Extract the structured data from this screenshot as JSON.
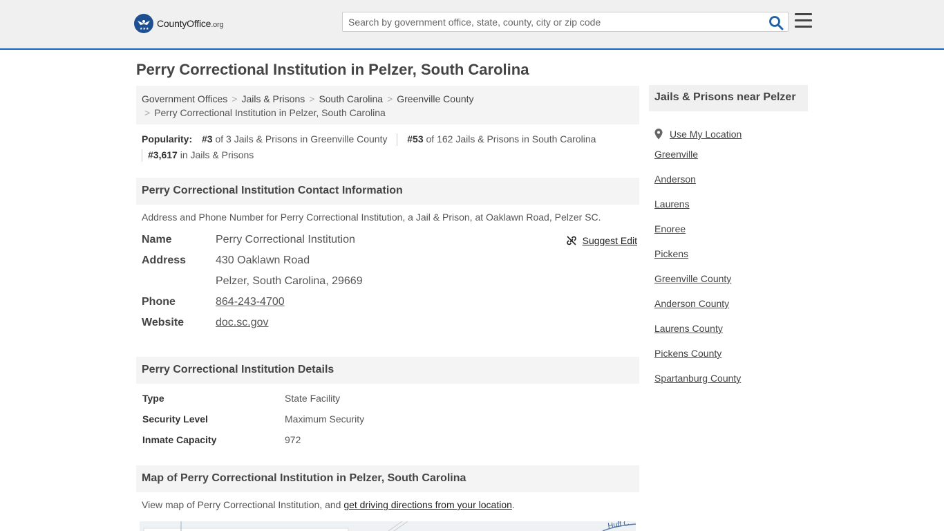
{
  "header": {
    "logo_brand": "CountyOffice",
    "logo_tld": ".org",
    "search_placeholder": "Search by government office, state, county, city or zip code"
  },
  "page_title": "Perry Correctional Institution in Pelzer, South Carolina",
  "breadcrumb": [
    "Government Offices",
    "Jails & Prisons",
    "South Carolina",
    "Greenville County",
    "Perry Correctional Institution in Pelzer, South Carolina"
  ],
  "popularity": {
    "label": "Popularity:",
    "items": [
      {
        "rank": "#3",
        "text": " of 3 Jails & Prisons in Greenville County"
      },
      {
        "rank": "#53",
        "text": " of 162 Jails & Prisons in South Carolina"
      },
      {
        "rank": "#3,617",
        "text": " in Jails & Prisons"
      }
    ]
  },
  "contact": {
    "heading": "Perry Correctional Institution Contact Information",
    "description": "Address and Phone Number for Perry Correctional Institution, a Jail & Prison, at Oaklawn Road, Pelzer SC.",
    "suggest_edit": "Suggest Edit",
    "name_label": "Name",
    "name": "Perry Correctional Institution",
    "address_label": "Address",
    "address_line1": "430 Oaklawn Road",
    "address_line2": "Pelzer, South Carolina, 29669",
    "phone_label": "Phone",
    "phone": "864-243-4700",
    "website_label": "Website",
    "website": "doc.sc.gov"
  },
  "details": {
    "heading": "Perry Correctional Institution Details",
    "rows": [
      {
        "label": "Type",
        "value": "State Facility"
      },
      {
        "label": "Security Level",
        "value": "Maximum Security"
      },
      {
        "label": "Inmate Capacity",
        "value": "972"
      }
    ]
  },
  "map": {
    "heading": "Map of Perry Correctional Institution in Pelzer, South Carolina",
    "text_prefix": "View map of Perry Correctional Institution, and ",
    "link": "get driving directions from your location",
    "text_suffix": ".",
    "road_label": "Huff C"
  },
  "sidebar": {
    "heading": "Jails & Prisons near Pelzer",
    "use_location": "Use My Location",
    "links": [
      "Greenville",
      "Anderson",
      "Laurens",
      "Enoree",
      "Pickens",
      "Greenville County",
      "Anderson County",
      "Laurens County",
      "Pickens County",
      "Spartanburg County"
    ]
  }
}
